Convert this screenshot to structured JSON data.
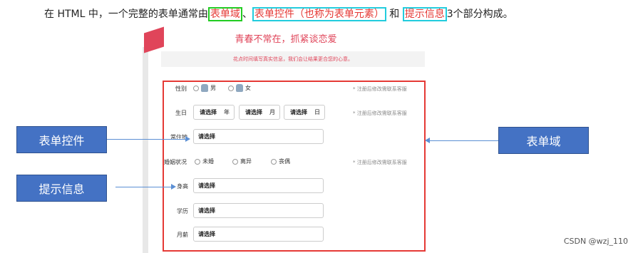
{
  "intro": {
    "prefix": "在 HTML 中，一个完整的表单通常由",
    "field": "表单域",
    "sep1": "、",
    "control": "表单控件（也称为表单元素）",
    "sep2": " 和 ",
    "info": "提示信息",
    "suffix": "3个部分构成。"
  },
  "form": {
    "title": "青春不常在，抓紧谈恋爱",
    "subtitle": "花点时间填写真实信息，我们会让结果更合您的心意。",
    "gender_label": "性别",
    "gender_male": "男",
    "gender_female": "女",
    "note": "* 注册后修改需联系客服",
    "birthday_label": "生日",
    "select_placeholder": "请选择",
    "year": "年",
    "month": "月",
    "day": "日",
    "residence_label": "常住地",
    "marital_label": "婚姻状况",
    "marital_options": [
      "未婚",
      "离异",
      "丧偶"
    ],
    "height_label": "身高",
    "education_label": "学历",
    "income_label": "月薪"
  },
  "annotations": {
    "control": "表单控件",
    "info": "提示信息",
    "field": "表单域"
  },
  "watermark": "CSDN @wzj_110",
  "colors": {
    "accent_red": "#e53935",
    "pink": "#e0455a",
    "blue": "#4472c4",
    "green": "#22cc22",
    "cyan": "#22ccdd"
  }
}
